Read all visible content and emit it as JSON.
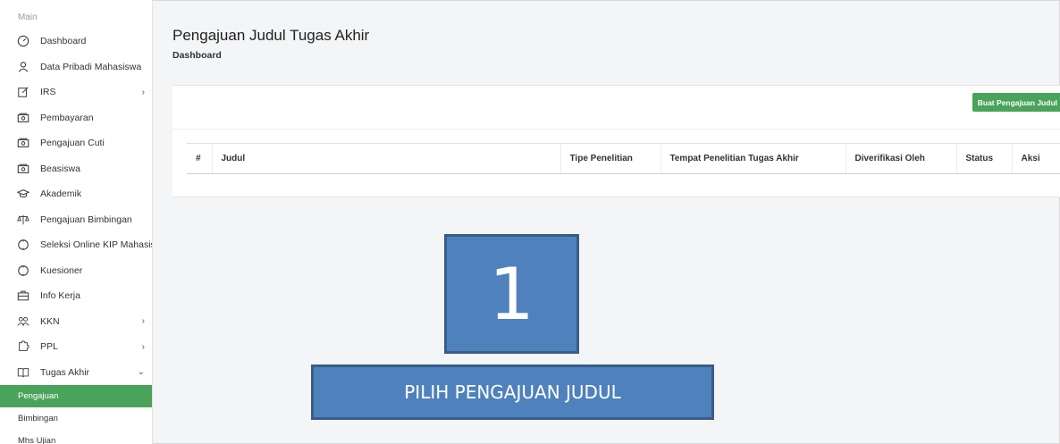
{
  "sidebar": {
    "section": "Main",
    "items": [
      {
        "label": "Dashboard",
        "icon": "gauge-icon",
        "name": "sidebar-item-dashboard"
      },
      {
        "label": "Data Pribadi Mahasiswa",
        "icon": "user-icon",
        "name": "sidebar-item-data-pribadi"
      },
      {
        "label": "IRS",
        "icon": "edit-icon",
        "name": "sidebar-item-irs",
        "caret": ">"
      },
      {
        "label": "Pembayaran",
        "icon": "money-icon",
        "name": "sidebar-item-pembayaran"
      },
      {
        "label": "Pengajuan Cuti",
        "icon": "money-icon",
        "name": "sidebar-item-pengajuan-cuti"
      },
      {
        "label": "Beasiswa",
        "icon": "money-icon",
        "name": "sidebar-item-beasiswa"
      },
      {
        "label": "Akademik",
        "icon": "graduation-cap-icon",
        "name": "sidebar-item-akademik"
      },
      {
        "label": "Pengajuan Bimbingan",
        "icon": "balance-scale-icon",
        "name": "sidebar-item-pengajuan-bimbingan"
      },
      {
        "label": "Seleksi Online KIP Mahasiswa",
        "icon": "circle-icon",
        "name": "sidebar-item-seleksi-kip"
      },
      {
        "label": "Kuesioner",
        "icon": "circle-icon",
        "name": "sidebar-item-kuesioner"
      },
      {
        "label": "Info Kerja",
        "icon": "briefcase-icon",
        "name": "sidebar-item-info-kerja"
      },
      {
        "label": "KKN",
        "icon": "users-icon",
        "name": "sidebar-item-kkn",
        "caret": ">"
      },
      {
        "label": "PPL",
        "icon": "puzzle-icon",
        "name": "sidebar-item-ppl",
        "caret": ">"
      },
      {
        "label": "Tugas Akhir",
        "icon": "book-icon",
        "name": "sidebar-item-tugas-akhir",
        "caret": "v"
      }
    ],
    "sub_items": [
      {
        "label": "Pengajuan",
        "active": true
      },
      {
        "label": "Bimbingan",
        "active": false
      },
      {
        "label": "Mhs Ujian",
        "active": false
      }
    ]
  },
  "header": {
    "title": "Pengajuan Judul Tugas Akhir",
    "breadcrumb": "Dashboard"
  },
  "card": {
    "add_button": "Buat Pengajuan Judul",
    "columns": [
      "#",
      "Judul",
      "Tipe Penelitian",
      "Tempat Penelitian Tugas Akhir",
      "Diverifikasi Oleh",
      "Status",
      "Aksi"
    ]
  },
  "callout": {
    "number": "1",
    "label": "PILIH PENGAJUAN JUDUL"
  },
  "colors": {
    "accent_green": "#4aa35a",
    "callout_blue": "#4f81bd",
    "callout_border": "#385d8a"
  }
}
